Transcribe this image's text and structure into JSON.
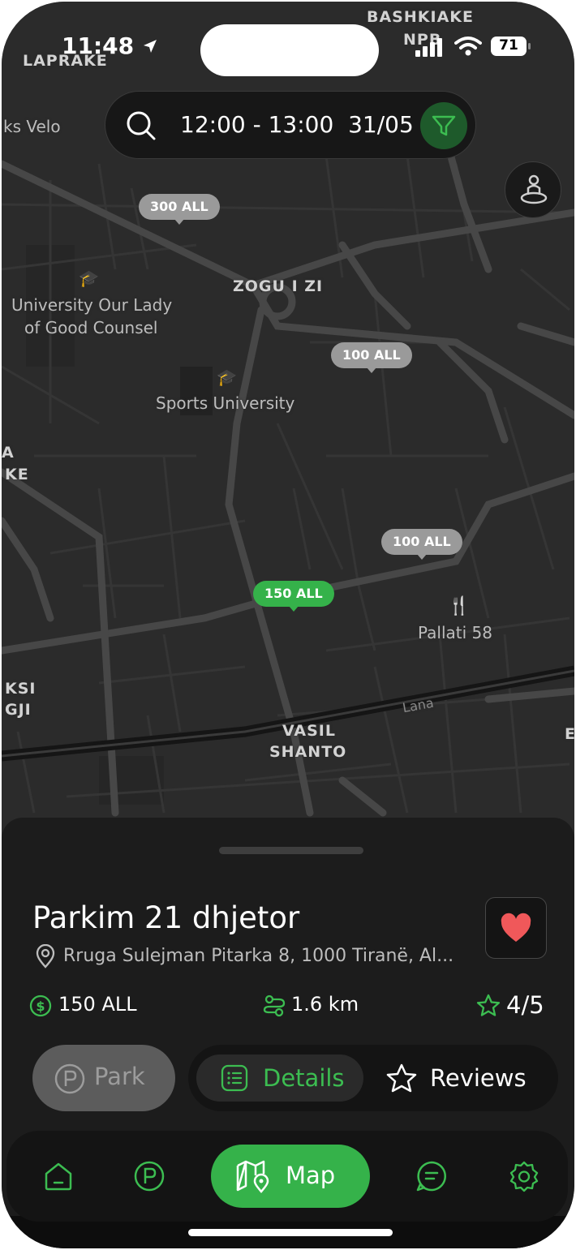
{
  "status": {
    "time": "11:48",
    "battery": "71"
  },
  "search": {
    "time_range": "12:00 - 13:00",
    "date": "31/05"
  },
  "map": {
    "labels": {
      "bashkiake": "BASHKIAKE",
      "npb": "NPB",
      "laprake": "LAPRAKE",
      "velo": "ks Velo",
      "university": "University Our Lady",
      "university2": "of Good Counsel",
      "zogu": "ZOGU I ZI",
      "sports": "Sports University",
      "ke": "KE",
      "a": "A",
      "pallati": "Pallati 58",
      "lana": "Lana",
      "vasil": "VASIL",
      "shanto": "SHANTO",
      "ksi": "KSI",
      "gji": "GJI",
      "e_edge": "E"
    },
    "pins": [
      "300 ALL",
      "100 ALL",
      "100 ALL",
      "150 ALL"
    ]
  },
  "sheet": {
    "title": "Parkim 21 dhjetor",
    "address": "Rruga Sulejman Pitarka 8, 1000 Tiranë, Al...",
    "price": "150 ALL",
    "distance": "1.6 km",
    "rating": "4/5",
    "park_label": "Park",
    "details_label": "Details",
    "reviews_label": "Reviews"
  },
  "tabs": {
    "map_label": "Map"
  },
  "colors": {
    "accent": "#35b24a",
    "heart": "#f0585a",
    "pin_gray": "#9a9a9a"
  },
  "icons": [
    "location-arrow-icon",
    "signal-icon",
    "wifi-icon",
    "battery-icon",
    "search-icon",
    "filter-icon",
    "person-location-icon",
    "heart-icon",
    "map-pin-icon",
    "dollar-icon",
    "route-icon",
    "star-icon",
    "parking-icon",
    "list-icon",
    "home-icon",
    "map-icon",
    "chat-icon",
    "gear-icon"
  ]
}
